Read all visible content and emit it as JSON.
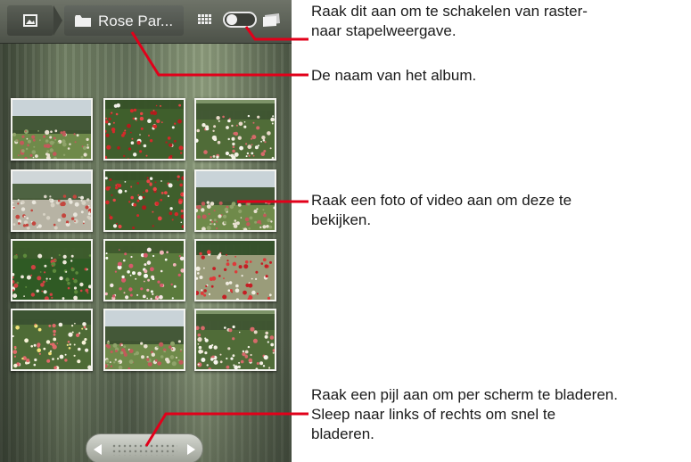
{
  "action_bar": {
    "home_icon": "picture-icon",
    "folder_icon": "folder-icon",
    "album_name": "Rose Par...",
    "grid_icon": "grid-view-icon",
    "stack_icon": "stack-view-icon"
  },
  "grid": {
    "rows": 4,
    "columns": 3,
    "photos": [
      {
        "name": "rose-garden-photo",
        "kind": "garden"
      },
      {
        "name": "rose-garden-photo",
        "kind": "red"
      },
      {
        "name": "rose-garden-photo",
        "kind": "white"
      },
      {
        "name": "rose-garden-photo",
        "kind": "balustrade"
      },
      {
        "name": "rose-garden-photo",
        "kind": "red"
      },
      {
        "name": "rose-garden-photo",
        "kind": "garden"
      },
      {
        "name": "rose-garden-photo",
        "kind": "hedge"
      },
      {
        "name": "rose-garden-photo",
        "kind": "pink"
      },
      {
        "name": "rose-garden-photo",
        "kind": "path"
      },
      {
        "name": "rose-garden-photo",
        "kind": "yellow"
      },
      {
        "name": "rose-garden-photo",
        "kind": "garden"
      },
      {
        "name": "rose-garden-photo",
        "kind": "white"
      }
    ]
  },
  "scroller": {
    "left_icon": "arrow-left-icon",
    "right_icon": "arrow-right-icon"
  },
  "callouts": {
    "toggle": "Raak dit aan om te schakelen van raster-\nnaar stapelweergave.",
    "album": "De naam van het album.",
    "photo": "Raak een foto of video aan om deze te\nbekijken.",
    "scroll": "Raak een pijl aan om per scherm te bladeren.\nSleep naar links of rechts om snel te\nbladeren."
  },
  "colors": {
    "callout_line": "#e2001a",
    "caption_text": "#1a1a1a"
  }
}
